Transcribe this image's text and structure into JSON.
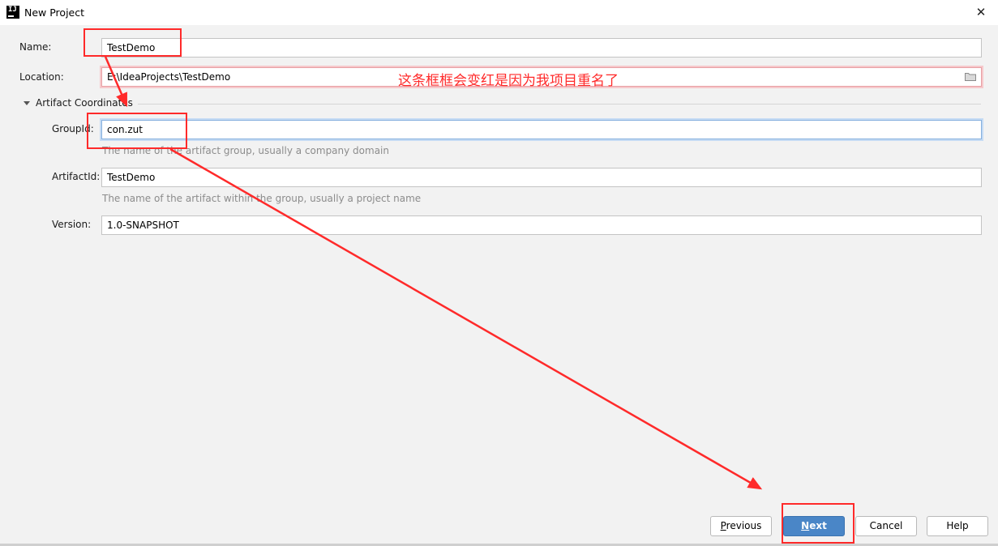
{
  "window": {
    "title": "New Project",
    "icon": "intellij-icon",
    "close_glyph": "✕"
  },
  "form": {
    "name": {
      "label": "Name:",
      "value": "TestDemo"
    },
    "location": {
      "label": "Location:",
      "value": "E:\\IdeaProjects\\TestDemo",
      "icon": "folder-icon"
    },
    "artifact_section": {
      "label": "Artifact Coordinates",
      "expanded": true
    },
    "group_id": {
      "label": "GroupId:",
      "value": "con.zut",
      "hint": "The name of the artifact group, usually a company domain"
    },
    "artifact_id": {
      "label": "ArtifactId:",
      "value": "TestDemo",
      "hint": "The name of the artifact within the group, usually a project name"
    },
    "version": {
      "label": "Version:",
      "value": "1.0-SNAPSHOT"
    }
  },
  "buttons": {
    "previous": {
      "label": "Previous",
      "mnemonic": "P"
    },
    "next": {
      "label": "Next",
      "mnemonic": "N"
    },
    "cancel": {
      "label": "Cancel"
    },
    "help": {
      "label": "Help"
    }
  },
  "annotation": {
    "note": "这条框框会变红是因为我项目重名了",
    "color": "#ff2a2a"
  },
  "colors": {
    "accent": "#4a86c7",
    "error_border": "#e8a0a4",
    "focus_border": "#86b0de"
  }
}
